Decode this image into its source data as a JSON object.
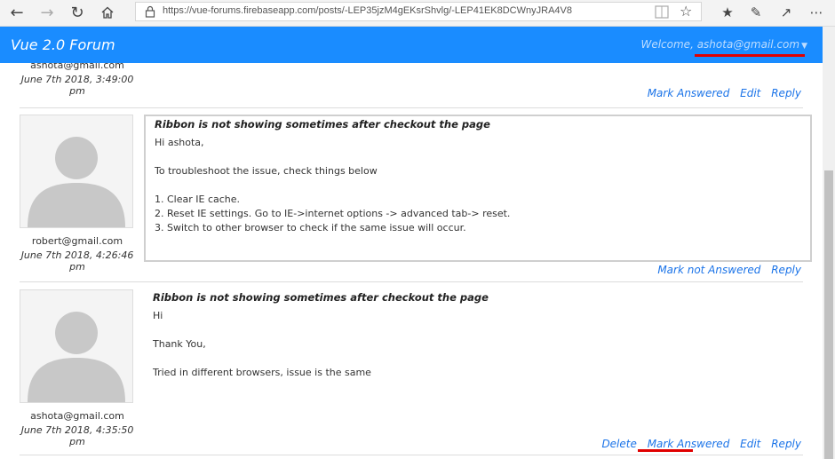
{
  "browser": {
    "url": "https://vue-forums.firebaseapp.com/posts/-LEP35jzM4gEKsrShvlg/-LEP41EK8DCWnyJRA4V8"
  },
  "app": {
    "title": "Vue 2.0 Forum",
    "welcome": "Welcome, ashota@gmail.com"
  },
  "colors": {
    "header": "#1a8cff",
    "link": "#1a73e8",
    "highlight": "#e00000"
  },
  "posts": [
    {
      "author": "ashota@gmail.com",
      "date": "June 7th 2018, 3:49:00 pm",
      "actions": [
        "Mark Answered",
        "Edit",
        "Reply"
      ]
    },
    {
      "author": "robert@gmail.com",
      "date": "June 7th 2018, 4:26:46 pm",
      "title": "Ribbon is not showing sometimes after checkout the page",
      "body": "Hi ashota,\n\nTo troubleshoot the issue, check things below\n\n1. Clear IE cache.\n2. Reset IE settings. Go to IE->internet options -> advanced tab-> reset.\n3. Switch to other browser to check if the same issue will occur.",
      "actions": [
        "Mark not Answered",
        "Reply"
      ]
    },
    {
      "author": "ashota@gmail.com",
      "date": "June 7th 2018, 4:35:50 pm",
      "title": "Ribbon is not showing sometimes after checkout the page",
      "body": "Hi\n\nThank You,\n\nTried in different browsers, issue is the same",
      "actions": [
        "Delete",
        "Mark Answered",
        "Edit",
        "Reply"
      ]
    }
  ]
}
